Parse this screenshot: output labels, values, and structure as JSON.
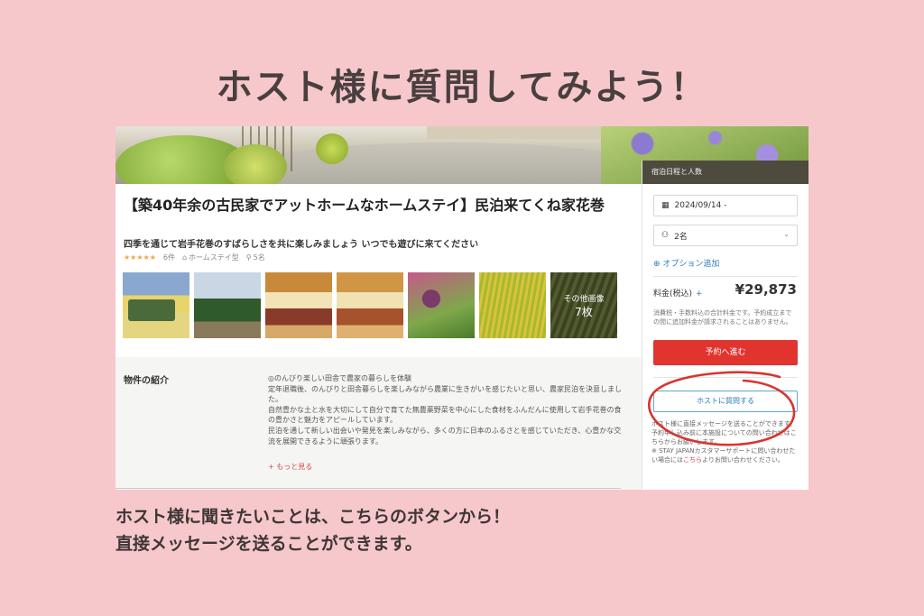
{
  "headline": "ホスト様に質問してみよう！",
  "listing": {
    "title": "【築40年余の古民家でアットホームなホームステイ】民泊来てくね家花巻",
    "subtitle": "四季を通じて岩手花巻のすばらしさを共に楽しみましょう いつでも遊びに来てください",
    "stars": "★★★★★",
    "reviews": "6件",
    "type": "ホームステイ型",
    "capacity": "5名",
    "more_photos_label": "その他画像",
    "more_photos_count": "7枚"
  },
  "intro": {
    "label": "物件の紹介",
    "lines": [
      "◎のんびり楽しい田舎で農家の暮らしを体験",
      "定年退職後、のんびりと田舎暮らしを楽しみながら農業に生きがいを感じたいと思い、農家民泊を決意しました。",
      "自然豊かな土と水を大切にして自分で育てた無農薬野菜を中心にした食材をふんだんに使用して岩手花巻の食の豊かさと魅力をアピールしています。",
      "民泊を通して新しい出会いや発見を楽しみながら、多くの方に日本のふるさとを感じていただき、心豊かな交流を展開できるように頑張ります。"
    ],
    "more": "+ もっと見る"
  },
  "booking": {
    "header": "宿泊日程と人数",
    "date": "2024/09/14 -",
    "guests": "2名",
    "option": "オプション追加",
    "price_label": "料金(税込)",
    "price_plus": "+",
    "price": "¥29,873",
    "price_note": "消費税・手数料込の合計料金です。予約成立までの間に追加料金が請求されることはありません。",
    "reserve": "予約へ進む",
    "ask": "ホストに質問する",
    "ask_note_1": "ホスト様に直接メッセージを送ることができます。予約申し込み前に本施設についての問い合わせはこちらからお願いします。",
    "ask_note_2": "※ STAY JAPANカスタマーサポートに問い合わせたい場合には",
    "ask_note_link": "こちら",
    "ask_note_3": "よりお問い合わせください。"
  },
  "caption": {
    "line1": "ホスト様に聞きたいことは、こちらのボタンから！",
    "line2": "直接メッセージを送ることができます。"
  },
  "colors": {
    "background": "#f6c8cc",
    "reserve": "#e2342f",
    "link": "#2d7cb8",
    "circle": "#d9342f"
  }
}
